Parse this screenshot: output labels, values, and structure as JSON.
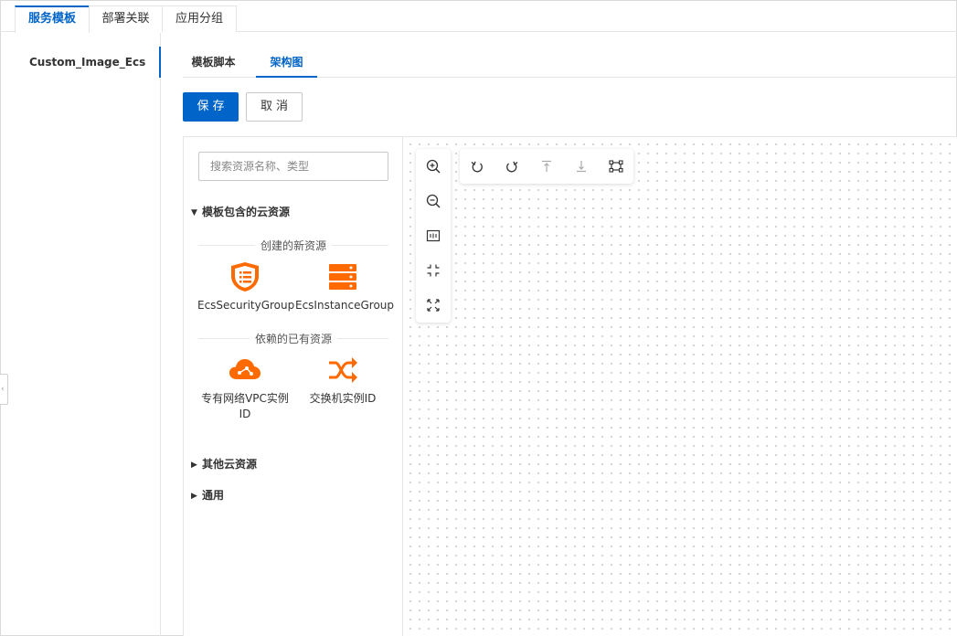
{
  "top_tabs": [
    "服务模板",
    "部署关联",
    "应用分组"
  ],
  "left_list": {
    "items": [
      "Custom_Image_Ecs"
    ]
  },
  "sub_tabs": [
    "模板脚本",
    "架构图"
  ],
  "buttons": {
    "save": "保存",
    "cancel": "取消"
  },
  "palette": {
    "search_placeholder": "搜索资源名称、类型",
    "groups": [
      {
        "label": "模板包含的云资源",
        "expanded": true,
        "sections": [
          {
            "label": "创建的新资源",
            "items": [
              {
                "label": "EcsSecurityGroup",
                "icon": "shield-list-icon"
              },
              {
                "label": "EcsInstanceGroup",
                "icon": "server-stack-icon"
              }
            ]
          },
          {
            "label": "依赖的已有资源",
            "items": [
              {
                "label": "专有网络VPC实例ID",
                "icon": "cloud-network-icon"
              },
              {
                "label": "交换机实例ID",
                "icon": "switch-arrows-icon"
              }
            ]
          }
        ]
      },
      {
        "label": "其他云资源",
        "expanded": false
      },
      {
        "label": "通用",
        "expanded": false
      }
    ]
  },
  "canvas_tools": {
    "vertical": [
      "zoom-in-icon",
      "zoom-out-icon",
      "fit-to-screen-icon",
      "exit-fullscreen-icon",
      "fullscreen-icon"
    ],
    "horizontal": [
      "undo-icon",
      "redo-icon",
      "bring-to-front-icon",
      "send-to-back-icon",
      "select-area-icon"
    ]
  },
  "colors": {
    "accent": "#0064c8",
    "resource_icon": "#ff6a00",
    "border": "#e5e5e5"
  }
}
